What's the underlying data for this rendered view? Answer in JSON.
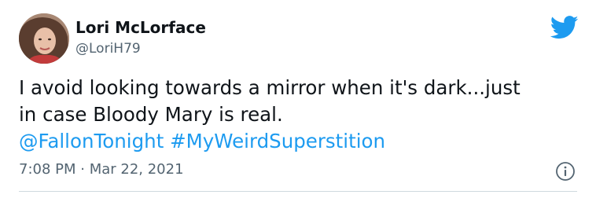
{
  "author": {
    "name": "Lori McLorface",
    "handle": "@LoriH79"
  },
  "tweet": {
    "line1": "I avoid looking towards a mirror when it's dark...just",
    "line2": "in case Bloody Mary is real.",
    "mention": "@FallonTonight",
    "hashtag": "#MyWeirdSuperstition"
  },
  "meta": {
    "time": "7:08 PM",
    "separator": " · ",
    "date": "Mar 22, 2021"
  },
  "icons": {
    "brand": "twitter-bird-icon",
    "info": "info-icon"
  },
  "colors": {
    "link": "#1d9bf0",
    "brand": "#1d9bf0",
    "secondary_text": "#536471"
  }
}
